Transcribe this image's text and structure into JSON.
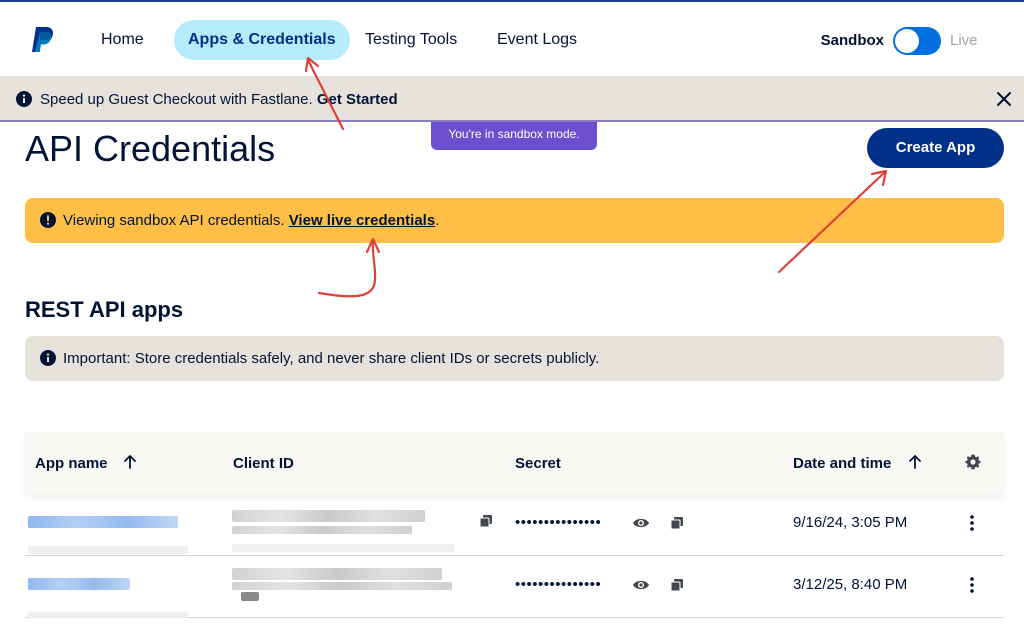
{
  "nav": {
    "home": "Home",
    "apps_credentials": "Apps & Credentials",
    "testing_tools": "Testing Tools",
    "event_logs": "Event Logs",
    "env_sandbox": "Sandbox",
    "env_live": "Live",
    "sandbox_enabled": true
  },
  "fastlane_banner": {
    "message": "Speed up Guest Checkout with Fastlane. ",
    "link": "Get Started"
  },
  "sandbox_pill": "You're in sandbox mode.",
  "page_title": "API Credentials",
  "create_app_label": "Create App",
  "warning_banner": {
    "message": "Viewing sandbox API credentials. ",
    "link": "View live credentials",
    "suffix": "."
  },
  "section_title": "REST API apps",
  "info_banner": {
    "message": "Important: Store credentials safely, and never share client IDs or secrets publicly."
  },
  "table": {
    "columns": [
      "App name",
      "Client ID",
      "Secret",
      "Date and time"
    ],
    "rows": [
      {
        "secret_masked": "•••••••••••••••",
        "date": "9/16/24, 3:05 PM"
      },
      {
        "secret_masked": "•••••••••••••••",
        "date": "3/12/25, 8:40 PM"
      }
    ]
  },
  "colors": {
    "brand_navy": "#003087",
    "nav_active_bg": "#b6ebfc",
    "toggle_blue": "#0070e0",
    "warning_bg": "#ffbf47",
    "neutral_banner_bg": "#e7e2dc",
    "sandbox_pill_bg": "#6c4fcf",
    "annotation_red": "#e0403a"
  },
  "icons": [
    "paypal-logo",
    "info-icon",
    "close-icon",
    "sort-arrow-up-icon",
    "gear-icon",
    "copy-icon",
    "eye-icon",
    "kebab-menu-icon"
  ]
}
